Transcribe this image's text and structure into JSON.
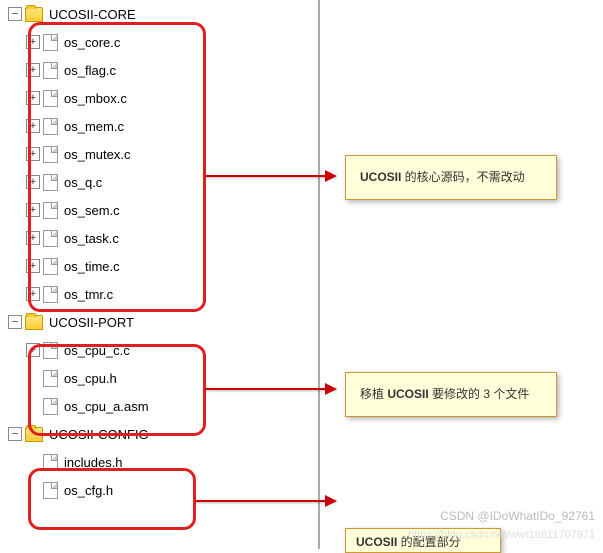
{
  "tree": {
    "folders": [
      {
        "name": "UCOSII-CORE",
        "expanded": true,
        "files": [
          {
            "name": "os_core.c",
            "expandable": true
          },
          {
            "name": "os_flag.c",
            "expandable": true
          },
          {
            "name": "os_mbox.c",
            "expandable": true
          },
          {
            "name": "os_mem.c",
            "expandable": true
          },
          {
            "name": "os_mutex.c",
            "expandable": true
          },
          {
            "name": "os_q.c",
            "expandable": true
          },
          {
            "name": "os_sem.c",
            "expandable": true
          },
          {
            "name": "os_task.c",
            "expandable": true
          },
          {
            "name": "os_time.c",
            "expandable": true
          },
          {
            "name": "os_tmr.c",
            "expandable": true
          }
        ]
      },
      {
        "name": "UCOSII-PORT",
        "expanded": true,
        "files": [
          {
            "name": "os_cpu_c.c",
            "expandable": true
          },
          {
            "name": "os_cpu.h",
            "expandable": false
          },
          {
            "name": "os_cpu_a.asm",
            "expandable": false
          }
        ]
      },
      {
        "name": "UCOSII-CONFIG",
        "expanded": true,
        "files": [
          {
            "name": "includes.h",
            "expandable": false
          },
          {
            "name": "os_cfg.h",
            "expandable": false
          }
        ]
      }
    ]
  },
  "notes": {
    "core_prefix": "UCOSII",
    "core_suffix": " 的核心源码，不需改动",
    "port_prefix": "移植 ",
    "port_mid": "UCOSII",
    "port_suffix": " 要修改的 3 个文件",
    "config_prefix": "UCOSII",
    "config_suffix": " 的配置部分"
  },
  "watermark": "CSDN @IDoWhatIDo_92761",
  "watermark2": "https://blog.csdn.net/wwt18811707971"
}
